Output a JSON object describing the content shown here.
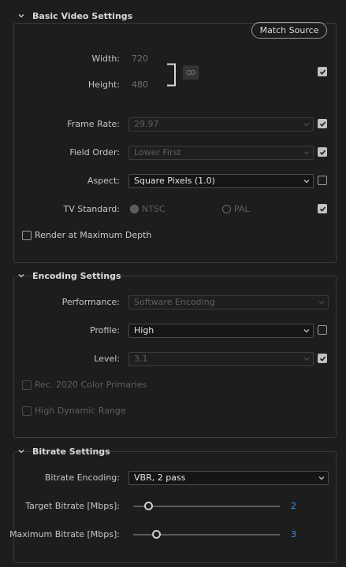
{
  "basic": {
    "title": "Basic Video Settings",
    "match_source": "Match Source",
    "width_label": "Width:",
    "width_value": "720",
    "height_label": "Height:",
    "height_value": "480",
    "frame_rate_label": "Frame Rate:",
    "frame_rate_value": "29.97",
    "field_order_label": "Field Order:",
    "field_order_value": "Lower First",
    "aspect_label": "Aspect:",
    "aspect_value": "Square Pixels (1.0)",
    "tv_standard_label": "TV Standard:",
    "tv_ntsc": "NTSC",
    "tv_pal": "PAL",
    "tv_selected": "NTSC",
    "render_max_depth": "Render at Maximum Depth",
    "checks": {
      "dimensions": true,
      "frame_rate": true,
      "field_order": true,
      "aspect": false,
      "tv_standard": true,
      "render_max_depth": false
    }
  },
  "encoding": {
    "title": "Encoding Settings",
    "performance_label": "Performance:",
    "performance_value": "Software Encoding",
    "profile_label": "Profile:",
    "profile_value": "High",
    "level_label": "Level:",
    "level_value": "3.1",
    "rec2020": "Rec. 2020 Color Primaries",
    "hdr": "High Dynamic Range",
    "checks": {
      "profile": false,
      "level": true,
      "rec2020": false,
      "hdr": false
    }
  },
  "bitrate": {
    "title": "Bitrate Settings",
    "encoding_label": "Bitrate Encoding:",
    "encoding_value": "VBR, 2 pass",
    "target_label": "Target Bitrate [Mbps]:",
    "target_value": "2",
    "max_label": "Maximum Bitrate [Mbps]:",
    "max_value": "3"
  },
  "colors": {
    "accent": "#3d92e8",
    "panel_bg": "#1d1d1d",
    "border": "#3a3a3a"
  }
}
